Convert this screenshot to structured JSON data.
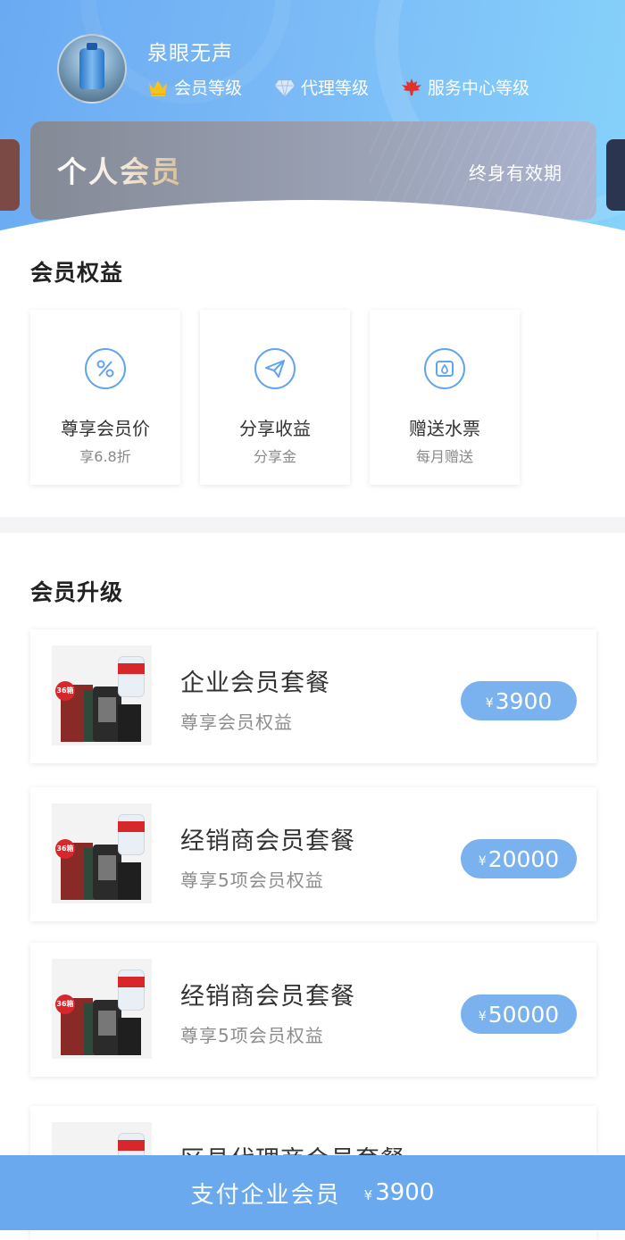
{
  "profile": {
    "username": "泉眼无声",
    "levels": [
      {
        "label": "会员等级",
        "icon": "crown-icon",
        "color": "#f6c21b"
      },
      {
        "label": "代理等级",
        "icon": "diamond-icon",
        "color": "#dbe8fb"
      },
      {
        "label": "服务中心等级",
        "icon": "maple-leaf-icon",
        "color": "#e0322a"
      }
    ]
  },
  "member_card": {
    "title": "个人会员",
    "validity": "终身有效期"
  },
  "benefits": {
    "title": "会员权益",
    "items": [
      {
        "name": "尊享会员价",
        "desc": "享6.8折",
        "icon": "percent-icon"
      },
      {
        "name": "分享收益",
        "desc": "分享金",
        "icon": "paper-plane-icon"
      },
      {
        "name": "赠送水票",
        "desc": "每月赠送",
        "icon": "ticket-icon"
      }
    ]
  },
  "upgrade": {
    "title": "会员升级",
    "packages": [
      {
        "title": "企业会员套餐",
        "subtitle": "尊享会员权益",
        "currency": "¥",
        "price": "3900"
      },
      {
        "title": "经销商会员套餐",
        "subtitle": "尊享5项会员权益",
        "currency": "¥",
        "price": "20000"
      },
      {
        "title": "经销商会员套餐",
        "subtitle": "尊享5项会员权益",
        "currency": "¥",
        "price": "50000"
      },
      {
        "title": "区县代理商会员套餐",
        "subtitle": "",
        "currency": "¥",
        "price": ""
      }
    ]
  },
  "pay_bar": {
    "label": "支付企业会员",
    "currency": "¥",
    "amount": "3900"
  },
  "colors": {
    "accent": "#6aa9ee",
    "price_pill": "#7ab2f0"
  }
}
